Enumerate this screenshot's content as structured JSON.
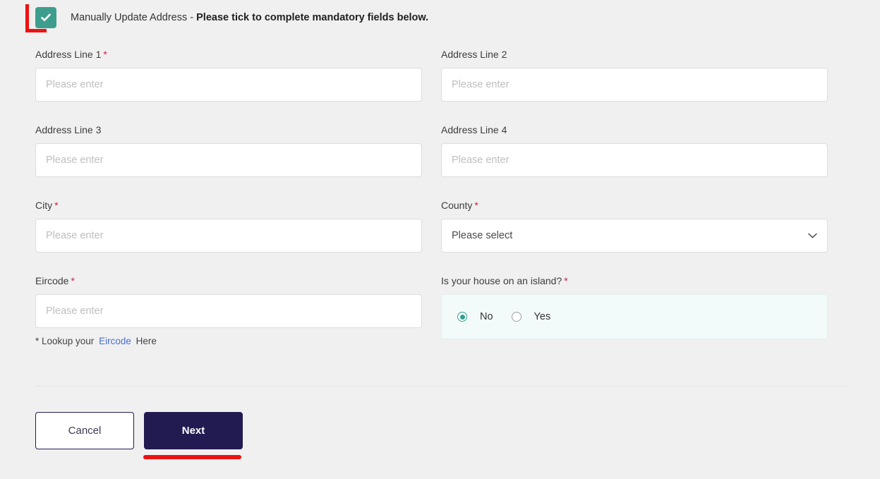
{
  "consent": {
    "checked": true,
    "icon": "check-icon",
    "label_normal": "Manually Update Address - ",
    "label_bold": "Please tick to complete mandatory fields below.",
    "checkbox_color": "#3e9e8e",
    "annotation_color": "#ee1111"
  },
  "fields": {
    "address1": {
      "label": "Address Line 1",
      "required": true,
      "required_mark": "*",
      "placeholder": "Please enter",
      "value": ""
    },
    "address2": {
      "label": "Address Line 2",
      "required": false,
      "required_mark": "",
      "placeholder": "Please enter",
      "value": ""
    },
    "address3": {
      "label": "Address Line 3",
      "required": false,
      "required_mark": "",
      "placeholder": "Please enter",
      "value": ""
    },
    "address4": {
      "label": "Address Line 4",
      "required": false,
      "required_mark": "",
      "placeholder": "Please enter",
      "value": ""
    },
    "city": {
      "label": "City",
      "required": true,
      "required_mark": "*",
      "placeholder": "Please enter",
      "value": ""
    },
    "county": {
      "label": "County",
      "required": true,
      "required_mark": "*",
      "selected": "Please select",
      "icon": "chevron-down-icon"
    },
    "eircode": {
      "label": "Eircode",
      "required": true,
      "required_mark": "*",
      "placeholder": "Please enter",
      "value": ""
    }
  },
  "eircode_hint": {
    "before": "* Lookup your",
    "link": "Eircode",
    "after": "Here",
    "link_color": "#4a6fd4"
  },
  "island": {
    "label": "Is your house on an island?",
    "required": true,
    "required_mark": "*",
    "selected": "No",
    "options": [
      {
        "label": "No",
        "selected": true
      },
      {
        "label": "Yes",
        "selected": false
      }
    ],
    "panel_color": "#f3fafa",
    "accent_color": "#2f9e8f"
  },
  "footer": {
    "cancel_label": "Cancel",
    "next_label": "Next",
    "next_color": "#211b51",
    "annotation_color": "#ee1111"
  }
}
